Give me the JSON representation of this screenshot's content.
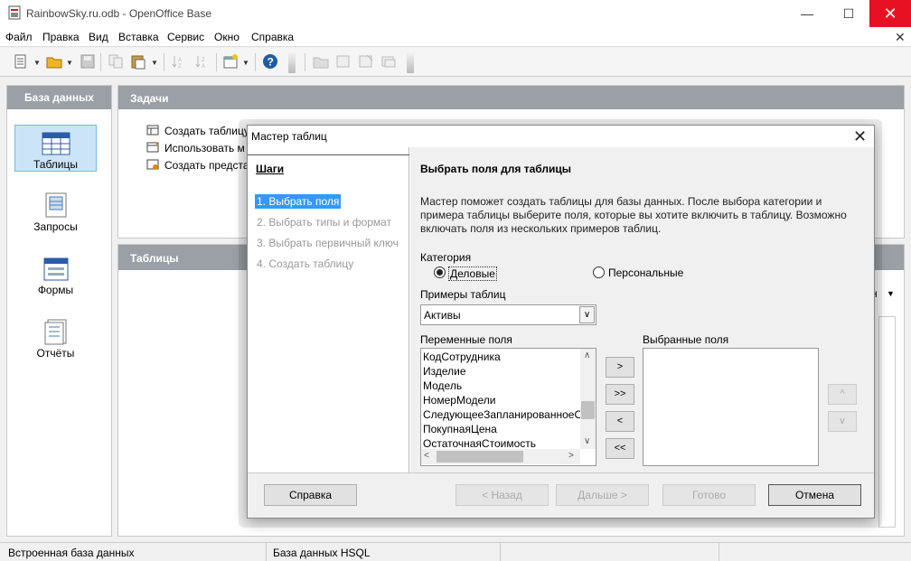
{
  "window": {
    "title": "RainbowSky.ru.odb - OpenOffice Base",
    "minimize": "—",
    "maximize": "☐",
    "close": "✕"
  },
  "menu": [
    "Файл",
    "Правка",
    "Вид",
    "Вставка",
    "Сервис",
    "Окно",
    "Справка"
  ],
  "doc_close": "✕",
  "sidebar": {
    "header": "База данных",
    "items": [
      {
        "label": "Таблицы",
        "icon": "tables-icon"
      },
      {
        "label": "Запросы",
        "icon": "queries-icon"
      },
      {
        "label": "Формы",
        "icon": "forms-icon"
      },
      {
        "label": "Отчёты",
        "icon": "reports-icon"
      }
    ]
  },
  "tasks": {
    "header": "Задачи",
    "items": [
      "Создать таблицу",
      "Использовать м",
      "Создать предста"
    ]
  },
  "tables": {
    "header": "Таблицы",
    "partial_label": "н"
  },
  "status": {
    "left": "Встроенная база данных",
    "right": "База данных HSQL"
  },
  "dialog": {
    "title": "Мастер таблиц",
    "close": "✕",
    "steps_title": "Шаги",
    "steps": [
      "1. Выбрать поля",
      "2. Выбрать типы и формат",
      "3. Выбрать первичный ключ",
      "4. Создать таблицу"
    ],
    "main_title": "Выбрать поля для таблицы",
    "description": "Мастер поможет создать таблицы для базы данных. После выбора категории и примера таблицы выберите поля, которые вы хотите включить в таблицу. Возможно включать поля из нескольких примеров таблиц.",
    "category_label": "Категория",
    "category_options": [
      "Деловые",
      "Персональные"
    ],
    "samples_label": "Примеры таблиц",
    "samples_value": "Активы",
    "available_label": "Переменные поля",
    "available_fields": [
      "КодСотрудника",
      "Изделие",
      "Модель",
      "НомерМодели",
      "СледующееЗапланированноеО",
      "ПокупнаяЦена",
      "ОстаточнаяСтоимость"
    ],
    "selected_label": "Выбранные поля",
    "move_buttons": [
      ">",
      ">>",
      "<",
      "<<"
    ],
    "order_buttons": [
      "^",
      "v"
    ],
    "buttons": {
      "help": "Справка",
      "back": "< Назад",
      "next": "Дальше >",
      "finish": "Готово",
      "cancel": "Отмена"
    }
  },
  "colors": {
    "panel_header": "#9aa0a6",
    "selection": "#3399ff",
    "close_red": "#e81123"
  }
}
